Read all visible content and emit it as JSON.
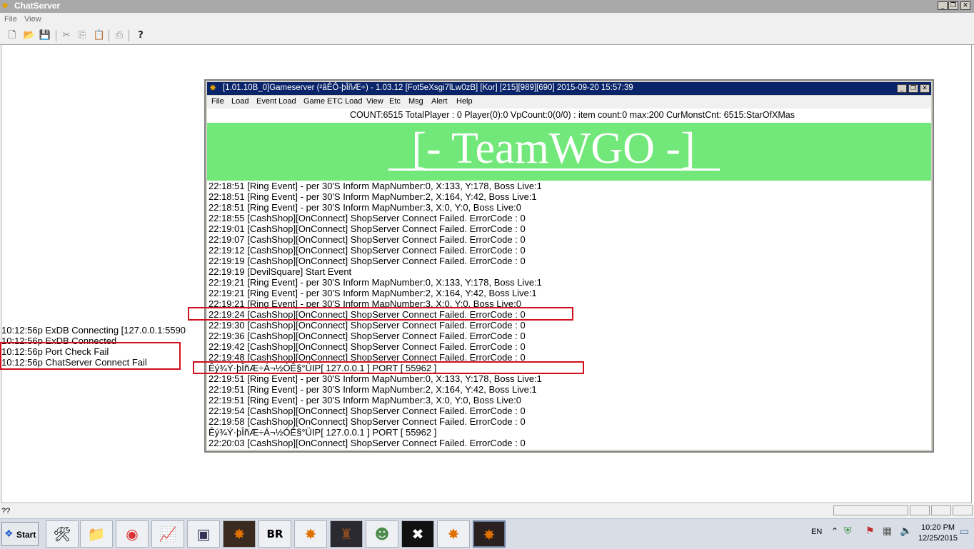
{
  "main_window": {
    "title": "ChatServer",
    "menu": [
      "File",
      "View"
    ],
    "controls": {
      "minimize": "_",
      "maximize": "❐",
      "close": "✕"
    }
  },
  "toolbar": {
    "buttons": [
      "new-icon",
      "open-icon",
      "save-icon",
      "cut-icon",
      "copy-icon",
      "paste-icon",
      "print-icon",
      "help-icon"
    ]
  },
  "chat_log": [
    "10:12:56p ExDB Connecting [127.0.0.1:5590",
    "10:12:56p ExDB Connected",
    "10:12:56p Port Check Fail",
    "10:12:56p ChatServer Connect Fail"
  ],
  "gameserver": {
    "title": "[1.01.10B_0]Gameserver (²âÊÔ·þÎñÆ÷) - 1.03.12 [Fot5eXsgi7lLw0zB] [Kor] [215][989][690] 2015-09-20 15:57:39",
    "menu": [
      "File",
      "Load",
      "Event Load",
      "Game ETC Load",
      "View",
      "Etc",
      "Msg",
      "Alert",
      "Help"
    ],
    "status": "COUNT:6515  TotalPlayer : 0  Player(0):0 VpCount:0(0/0) : item count:0 max:200 CurMonstCnt: 6515:StarOfXMas",
    "banner": "[-  TeamWGO -]",
    "log": [
      "22:18:51 [Ring Event] - per 30'S Inform MapNumber:0, X:133, Y:178, Boss Live:1",
      "22:18:51 [Ring Event] - per 30'S Inform MapNumber:2, X:164, Y:42, Boss Live:1",
      "22:18:51 [Ring Event] - per 30'S Inform MapNumber:3, X:0, Y:0, Boss Live:0",
      "22:18:55 [CashShop][OnConnect] ShopServer Connect Failed. ErrorCode : 0",
      "22:19:01 [CashShop][OnConnect] ShopServer Connect Failed. ErrorCode : 0",
      "22:19:07 [CashShop][OnConnect] ShopServer Connect Failed. ErrorCode : 0",
      "22:19:12 [CashShop][OnConnect] ShopServer Connect Failed. ErrorCode : 0",
      "22:19:19 [CashShop][OnConnect] ShopServer Connect Failed. ErrorCode : 0",
      "22:19:19 [DevilSquare] Start Event",
      "22:19:21 [Ring Event] - per 30'S Inform MapNumber:0, X:133, Y:178, Boss Live:1",
      "22:19:21 [Ring Event] - per 30'S Inform MapNumber:2, X:164, Y:42, Boss Live:1",
      "22:19:21 [Ring Event] - per 30'S Inform MapNumber:3, X:0, Y:0, Boss Live:0",
      "22:19:24 [CashShop][OnConnect] ShopServer Connect Failed. ErrorCode : 0",
      "22:19:30 [CashShop][OnConnect] ShopServer Connect Failed. ErrorCode : 0",
      "22:19:36 [CashShop][OnConnect] ShopServer Connect Failed. ErrorCode : 0",
      "22:19:42 [CashShop][OnConnect] ShopServer Connect Failed. ErrorCode : 0",
      "22:19:48 [CashShop][OnConnect] ShopServer Connect Failed. ErrorCode : 0",
      "Êý¾Ý·þÎñÆ÷Á¬½ÓÊ§°ÜIP[ 127.0.0.1 ] PORT [ 55962 ]",
      "22:19:51 [Ring Event] - per 30'S Inform MapNumber:0, X:133, Y:178, Boss Live:1",
      "22:19:51 [Ring Event] - per 30'S Inform MapNumber:2, X:164, Y:42, Boss Live:1",
      "22:19:51 [Ring Event] - per 30'S Inform MapNumber:3, X:0, Y:0, Boss Live:0",
      "22:19:54 [CashShop][OnConnect] ShopServer Connect Failed. ErrorCode : 0",
      "22:19:58 [CashShop][OnConnect] ShopServer Connect Failed. ErrorCode : 0",
      "Êý¾Ý·þÎñÆ÷Á¬½ÓÊ§°ÜIP[ 127.0.0.1 ] PORT [ 55962 ]",
      "22:20:03 [CashShop][OnConnect] ShopServer Connect Failed. ErrorCode : 0"
    ]
  },
  "statusbar": {
    "text": "??"
  },
  "taskbar": {
    "start_label": "Start",
    "apps": [
      {
        "name": "tools-app-icon",
        "glyph": "🛠"
      },
      {
        "name": "explorer-folder-icon",
        "glyph": "📁"
      },
      {
        "name": "chrome-icon",
        "glyph": "◉"
      },
      {
        "name": "chart-app-icon",
        "glyph": "📈"
      },
      {
        "name": "window-app-icon",
        "glyph": "▣"
      },
      {
        "name": "mu-server-icon",
        "glyph": "✸"
      },
      {
        "name": "br-app-icon",
        "glyph": "BR"
      },
      {
        "name": "mu-server-icon",
        "glyph": "✸"
      },
      {
        "name": "game-app-icon",
        "glyph": "♜"
      },
      {
        "name": "dragon-app-icon",
        "glyph": "☻"
      },
      {
        "name": "ex-app-icon",
        "glyph": "✖"
      },
      {
        "name": "mu-server-icon",
        "glyph": "✸"
      },
      {
        "name": "mu-server-icon",
        "glyph": "✸"
      }
    ],
    "language": "EN",
    "clock_time": "10:20 PM",
    "clock_date": "12/25/2015"
  }
}
